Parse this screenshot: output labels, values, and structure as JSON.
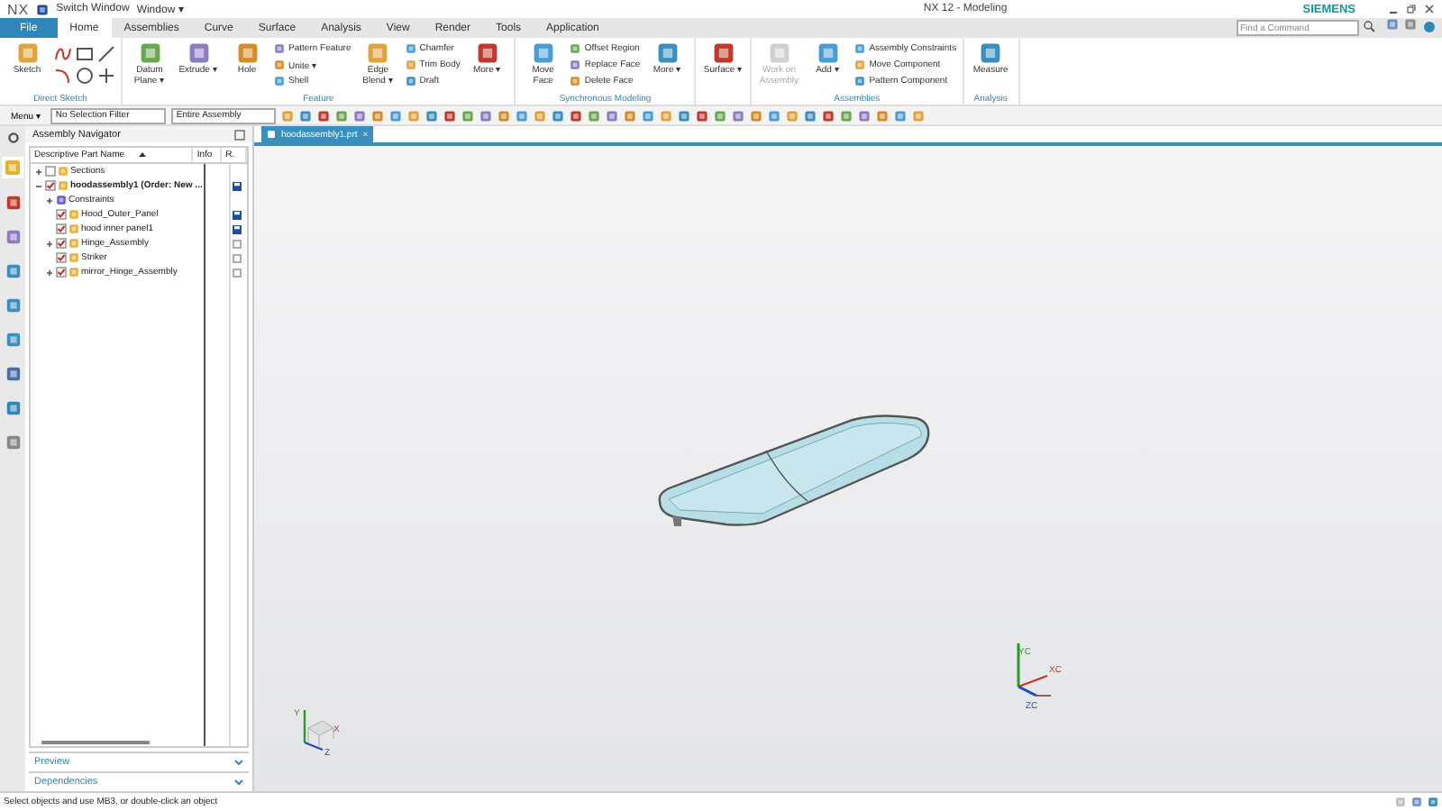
{
  "title_bar": {
    "logo": "NX",
    "quick_access": [
      "Switch Window",
      "Window ▾"
    ],
    "title": "NX 12 - Modeling",
    "brand": "SIEMENS"
  },
  "tabs": [
    {
      "label": "File",
      "kind": "file",
      "selected": false
    },
    {
      "label": "Home",
      "kind": "tab",
      "selected": true
    },
    {
      "label": "Assemblies",
      "kind": "tab",
      "selected": false
    },
    {
      "label": "Curve",
      "kind": "tab",
      "selected": false
    },
    {
      "label": "Surface",
      "kind": "tab",
      "selected": false
    },
    {
      "label": "Analysis",
      "kind": "tab",
      "selected": false
    },
    {
      "label": "View",
      "kind": "tab",
      "selected": false
    },
    {
      "label": "Render",
      "kind": "tab",
      "selected": false
    },
    {
      "label": "Tools",
      "kind": "tab",
      "selected": false
    },
    {
      "label": "Application",
      "kind": "tab",
      "selected": false
    }
  ],
  "command_search": {
    "placeholder": "Find a Command"
  },
  "ribbon": [
    {
      "label": "Direct Sketch",
      "items": [
        {
          "kind": "large",
          "label": "Sketch",
          "disabled": false
        },
        {
          "kind": "sketch_grid"
        }
      ]
    },
    {
      "label": "Feature",
      "items": [
        {
          "kind": "large",
          "label": "Datum Plane ▾",
          "disabled": false
        },
        {
          "kind": "large",
          "label": "Extrude ▾",
          "disabled": false
        },
        {
          "kind": "large",
          "label": "Hole",
          "disabled": false
        },
        {
          "kind": "stack",
          "labels": [
            "Pattern Feature",
            "Unite ▾",
            "Shell"
          ]
        },
        {
          "kind": "large",
          "label": "Edge Blend ▾",
          "disabled": false
        },
        {
          "kind": "stack",
          "labels": [
            "Chamfer",
            "Trim Body",
            "Draft"
          ]
        },
        {
          "kind": "large",
          "label": "More ▾",
          "disabled": false
        }
      ]
    },
    {
      "label": "Synchronous Modeling",
      "items": [
        {
          "kind": "large",
          "label": "Move Face",
          "disabled": false
        },
        {
          "kind": "stack",
          "labels": [
            "Offset Region",
            "Replace Face",
            "Delete Face"
          ]
        },
        {
          "kind": "large",
          "label": "More ▾",
          "disabled": false
        }
      ]
    },
    {
      "items": [
        {
          "kind": "large",
          "label": "Surface ▾",
          "disabled": false
        }
      ]
    },
    {
      "label": "Assemblies",
      "items": [
        {
          "kind": "large",
          "label": "Work on Assembly",
          "disabled": true
        },
        {
          "kind": "large",
          "label": "Add ▾",
          "disabled": false
        },
        {
          "kind": "stack",
          "labels": [
            "Assembly Constraints",
            "Move Component",
            "Pattern Component"
          ]
        }
      ]
    },
    {
      "label": "Analysis",
      "items": [
        {
          "kind": "large",
          "label": "Measure",
          "disabled": false
        }
      ]
    }
  ],
  "toolbar": {
    "menu": "Menu ▾",
    "selection_filter": "No Selection Filter",
    "scope": "Entire Assembly"
  },
  "navigator": {
    "title": "Assembly Navigator",
    "columns": [
      "Descriptive Part Name",
      "Info",
      "R."
    ],
    "tree": [
      {
        "name": "Sections",
        "checked": false,
        "expanded": false
      },
      {
        "name": "hoodassembly1 (Order: New ...",
        "checked": true,
        "expanded": true,
        "loaded": true,
        "bold": true,
        "children": [
          {
            "name": "Constraints",
            "expanded": false
          },
          {
            "name": "Hood_Outer_Panel",
            "checked": true,
            "loaded": true
          },
          {
            "name": "hood inner panel1",
            "checked": true,
            "loaded": true
          },
          {
            "name": "Hinge_Assembly",
            "checked": true,
            "expanded": false,
            "loaded": false
          },
          {
            "name": "Striker",
            "checked": true,
            "loaded": false
          },
          {
            "name": "mirror_Hinge_Assembly",
            "checked": true,
            "expanded": false,
            "loaded": false
          }
        ]
      }
    ],
    "panels": [
      "Preview",
      "Dependencies"
    ]
  },
  "viewport": {
    "tab": {
      "label": "hoodassembly1.prt",
      "close": "×"
    },
    "view_triad": [
      "XC",
      "YC",
      "ZC"
    ],
    "mini_triad": [
      "Y",
      "X",
      "Z"
    ]
  },
  "status_bar": {
    "message": "Select objects and use MB3, or double-click an object"
  }
}
